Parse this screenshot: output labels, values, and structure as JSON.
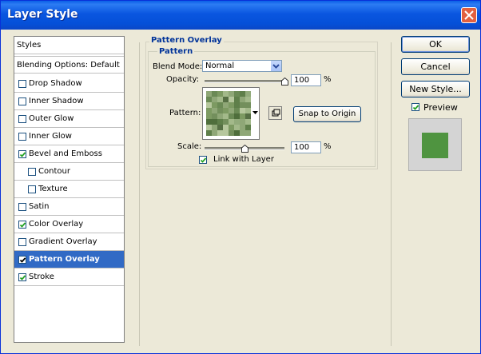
{
  "window": {
    "title": "Layer Style"
  },
  "left_panel": {
    "header": "Styles",
    "blending": "Blending Options: Default",
    "items": [
      {
        "label": "Drop Shadow",
        "checked": false,
        "indent": false,
        "selected": false
      },
      {
        "label": "Inner Shadow",
        "checked": false,
        "indent": false,
        "selected": false
      },
      {
        "label": "Outer Glow",
        "checked": false,
        "indent": false,
        "selected": false
      },
      {
        "label": "Inner Glow",
        "checked": false,
        "indent": false,
        "selected": false
      },
      {
        "label": "Bevel and Emboss",
        "checked": true,
        "indent": false,
        "selected": false
      },
      {
        "label": "Contour",
        "checked": false,
        "indent": true,
        "selected": false
      },
      {
        "label": "Texture",
        "checked": false,
        "indent": true,
        "selected": false
      },
      {
        "label": "Satin",
        "checked": false,
        "indent": false,
        "selected": false
      },
      {
        "label": "Color Overlay",
        "checked": true,
        "indent": false,
        "selected": false
      },
      {
        "label": "Gradient Overlay",
        "checked": false,
        "indent": false,
        "selected": false
      },
      {
        "label": "Pattern Overlay",
        "checked": true,
        "indent": false,
        "selected": true
      },
      {
        "label": "Stroke",
        "checked": true,
        "indent": false,
        "selected": false
      }
    ]
  },
  "pattern_overlay": {
    "section_title": "Pattern Overlay",
    "group_title": "Pattern",
    "blend_mode_label": "Blend Mode:",
    "blend_mode_value": "Normal",
    "opacity_label": "Opacity:",
    "opacity_value": "100",
    "opacity_level": 100,
    "percent": "%",
    "pattern_label": "Pattern:",
    "snap_button": "Snap to Origin",
    "scale_label": "Scale:",
    "scale_value": "100",
    "link_label": "Link with Layer",
    "link_checked": true
  },
  "buttons": {
    "ok": "OK",
    "cancel": "Cancel",
    "new_style": "New Style..."
  },
  "preview": {
    "label": "Preview",
    "checked": true
  },
  "colors": {
    "titlebar": "#0a56e0",
    "selection": "#316ac5",
    "group_title": "#003399",
    "preview_swatch": "#4f9440"
  }
}
